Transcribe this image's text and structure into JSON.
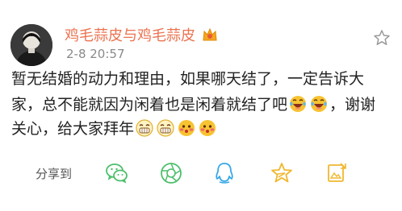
{
  "user": {
    "name": "鸡毛蒜皮与鸡毛蒜皮",
    "time": "2-8 20:57"
  },
  "post": {
    "line1": "暂无结婚的动力和理由，如果哪天结了，一定告诉大",
    "line2_text": "家，总不能就因为闲着也是闲着就结了吧",
    "line2_end": "，谢谢",
    "line3_text": "关心，给大家拜年",
    "emojis_line2": [
      "laughing-tears-emoji",
      "laughing-tears-emoji"
    ],
    "emojis_line3": [
      "grin-emoji",
      "grin-emoji",
      "blush-emoji",
      "blush-emoji"
    ]
  },
  "share": {
    "label": "分享到",
    "targets": [
      "wechat-icon",
      "moments-icon",
      "qq-icon",
      "qzone-icon",
      "screenshot-icon"
    ]
  },
  "colors": {
    "name": "#eb7350",
    "share_green": "#4cbf6b",
    "share_blue": "#36a8e6",
    "share_yellow": "#f0b830",
    "emoji_yellow": "#f7c331"
  }
}
